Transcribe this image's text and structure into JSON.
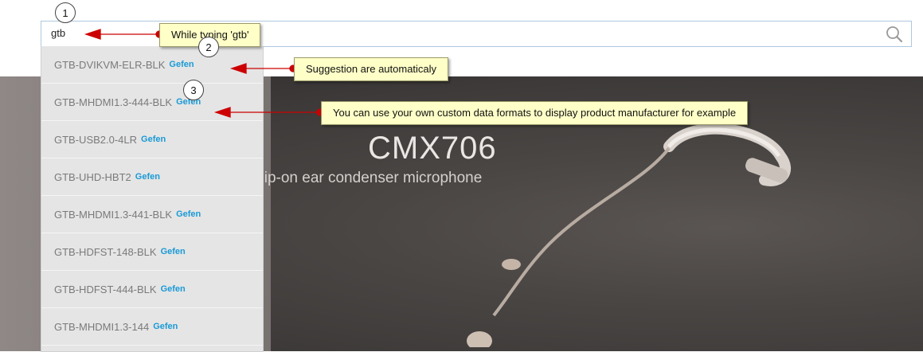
{
  "search": {
    "value": "gtb"
  },
  "banner": {
    "title": "CMX706",
    "subtitle": "clip-on ear condenser microphone"
  },
  "suggestions": [
    {
      "sku": "GTB-DVIKVM-ELR-BLK",
      "manufacturer": "Gefen"
    },
    {
      "sku": "GTB-MHDMI1.3-444-BLK",
      "manufacturer": "Gefen"
    },
    {
      "sku": "GTB-USB2.0-4LR",
      "manufacturer": "Gefen"
    },
    {
      "sku": "GTB-UHD-HBT2",
      "manufacturer": "Gefen"
    },
    {
      "sku": "GTB-MHDMI1.3-441-BLK",
      "manufacturer": "Gefen"
    },
    {
      "sku": "GTB-HDFST-148-BLK",
      "manufacturer": "Gefen"
    },
    {
      "sku": "GTB-HDFST-444-BLK",
      "manufacturer": "Gefen"
    },
    {
      "sku": "GTB-MHDMI1.3-144",
      "manufacturer": "Gefen"
    }
  ],
  "callouts": [
    {
      "number": "1",
      "text": "While typing 'gtb'"
    },
    {
      "number": "2",
      "text": "Suggestion are automaticaly"
    },
    {
      "number": "3",
      "text": "You can use your own custom data formats to display product manufacturer for example"
    }
  ],
  "colors": {
    "callout_bg": "#ffffc8",
    "arrow": "#cc0000",
    "manufacturer_link": "#1a9ad6"
  }
}
